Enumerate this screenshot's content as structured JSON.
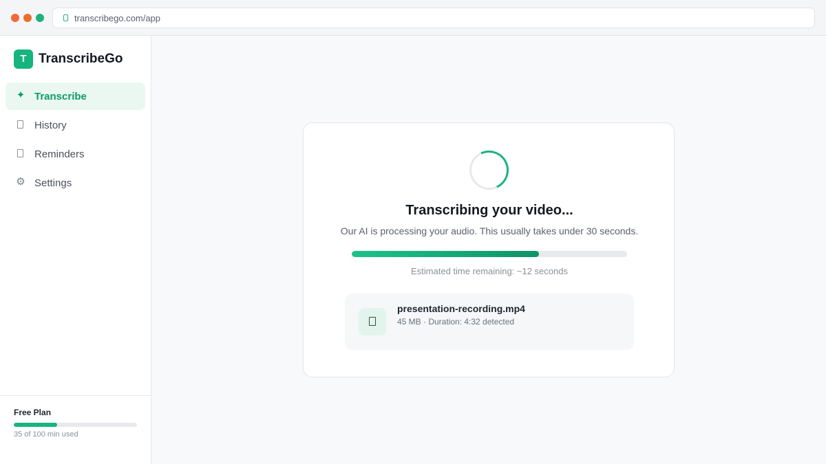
{
  "browser": {
    "url": "transcribego.com/app",
    "dot_colors": [
      "#f0693a",
      "#e8702c",
      "#22b07d"
    ]
  },
  "brand": {
    "logo_letter": "T",
    "name": "TranscribeGo",
    "accent": "#16b47f"
  },
  "nav": [
    {
      "label": "Transcribe",
      "icon": "sparkle-icon",
      "glyph": "✦",
      "active": true
    },
    {
      "label": "History",
      "icon": "history-icon",
      "glyph": "",
      "active": false
    },
    {
      "label": "Reminders",
      "icon": "reminder-icon",
      "glyph": "",
      "active": false
    },
    {
      "label": "Settings",
      "icon": "gear-icon",
      "glyph": "⚙",
      "active": false
    }
  ],
  "plan": {
    "title": "Free Plan",
    "usage": "35 of 100 min used",
    "used_fraction": 0.35
  },
  "status": {
    "title": "Transcribing your video...",
    "subtitle": "Our AI is processing your audio. This usually takes under 30 seconds.",
    "progress_fraction": 0.68,
    "eta": "Estimated time remaining: ~12 seconds"
  },
  "file": {
    "name": "presentation-recording.mp4",
    "meta": "45 MB · Duration: 4:32 detected",
    "icon": "file-icon"
  }
}
